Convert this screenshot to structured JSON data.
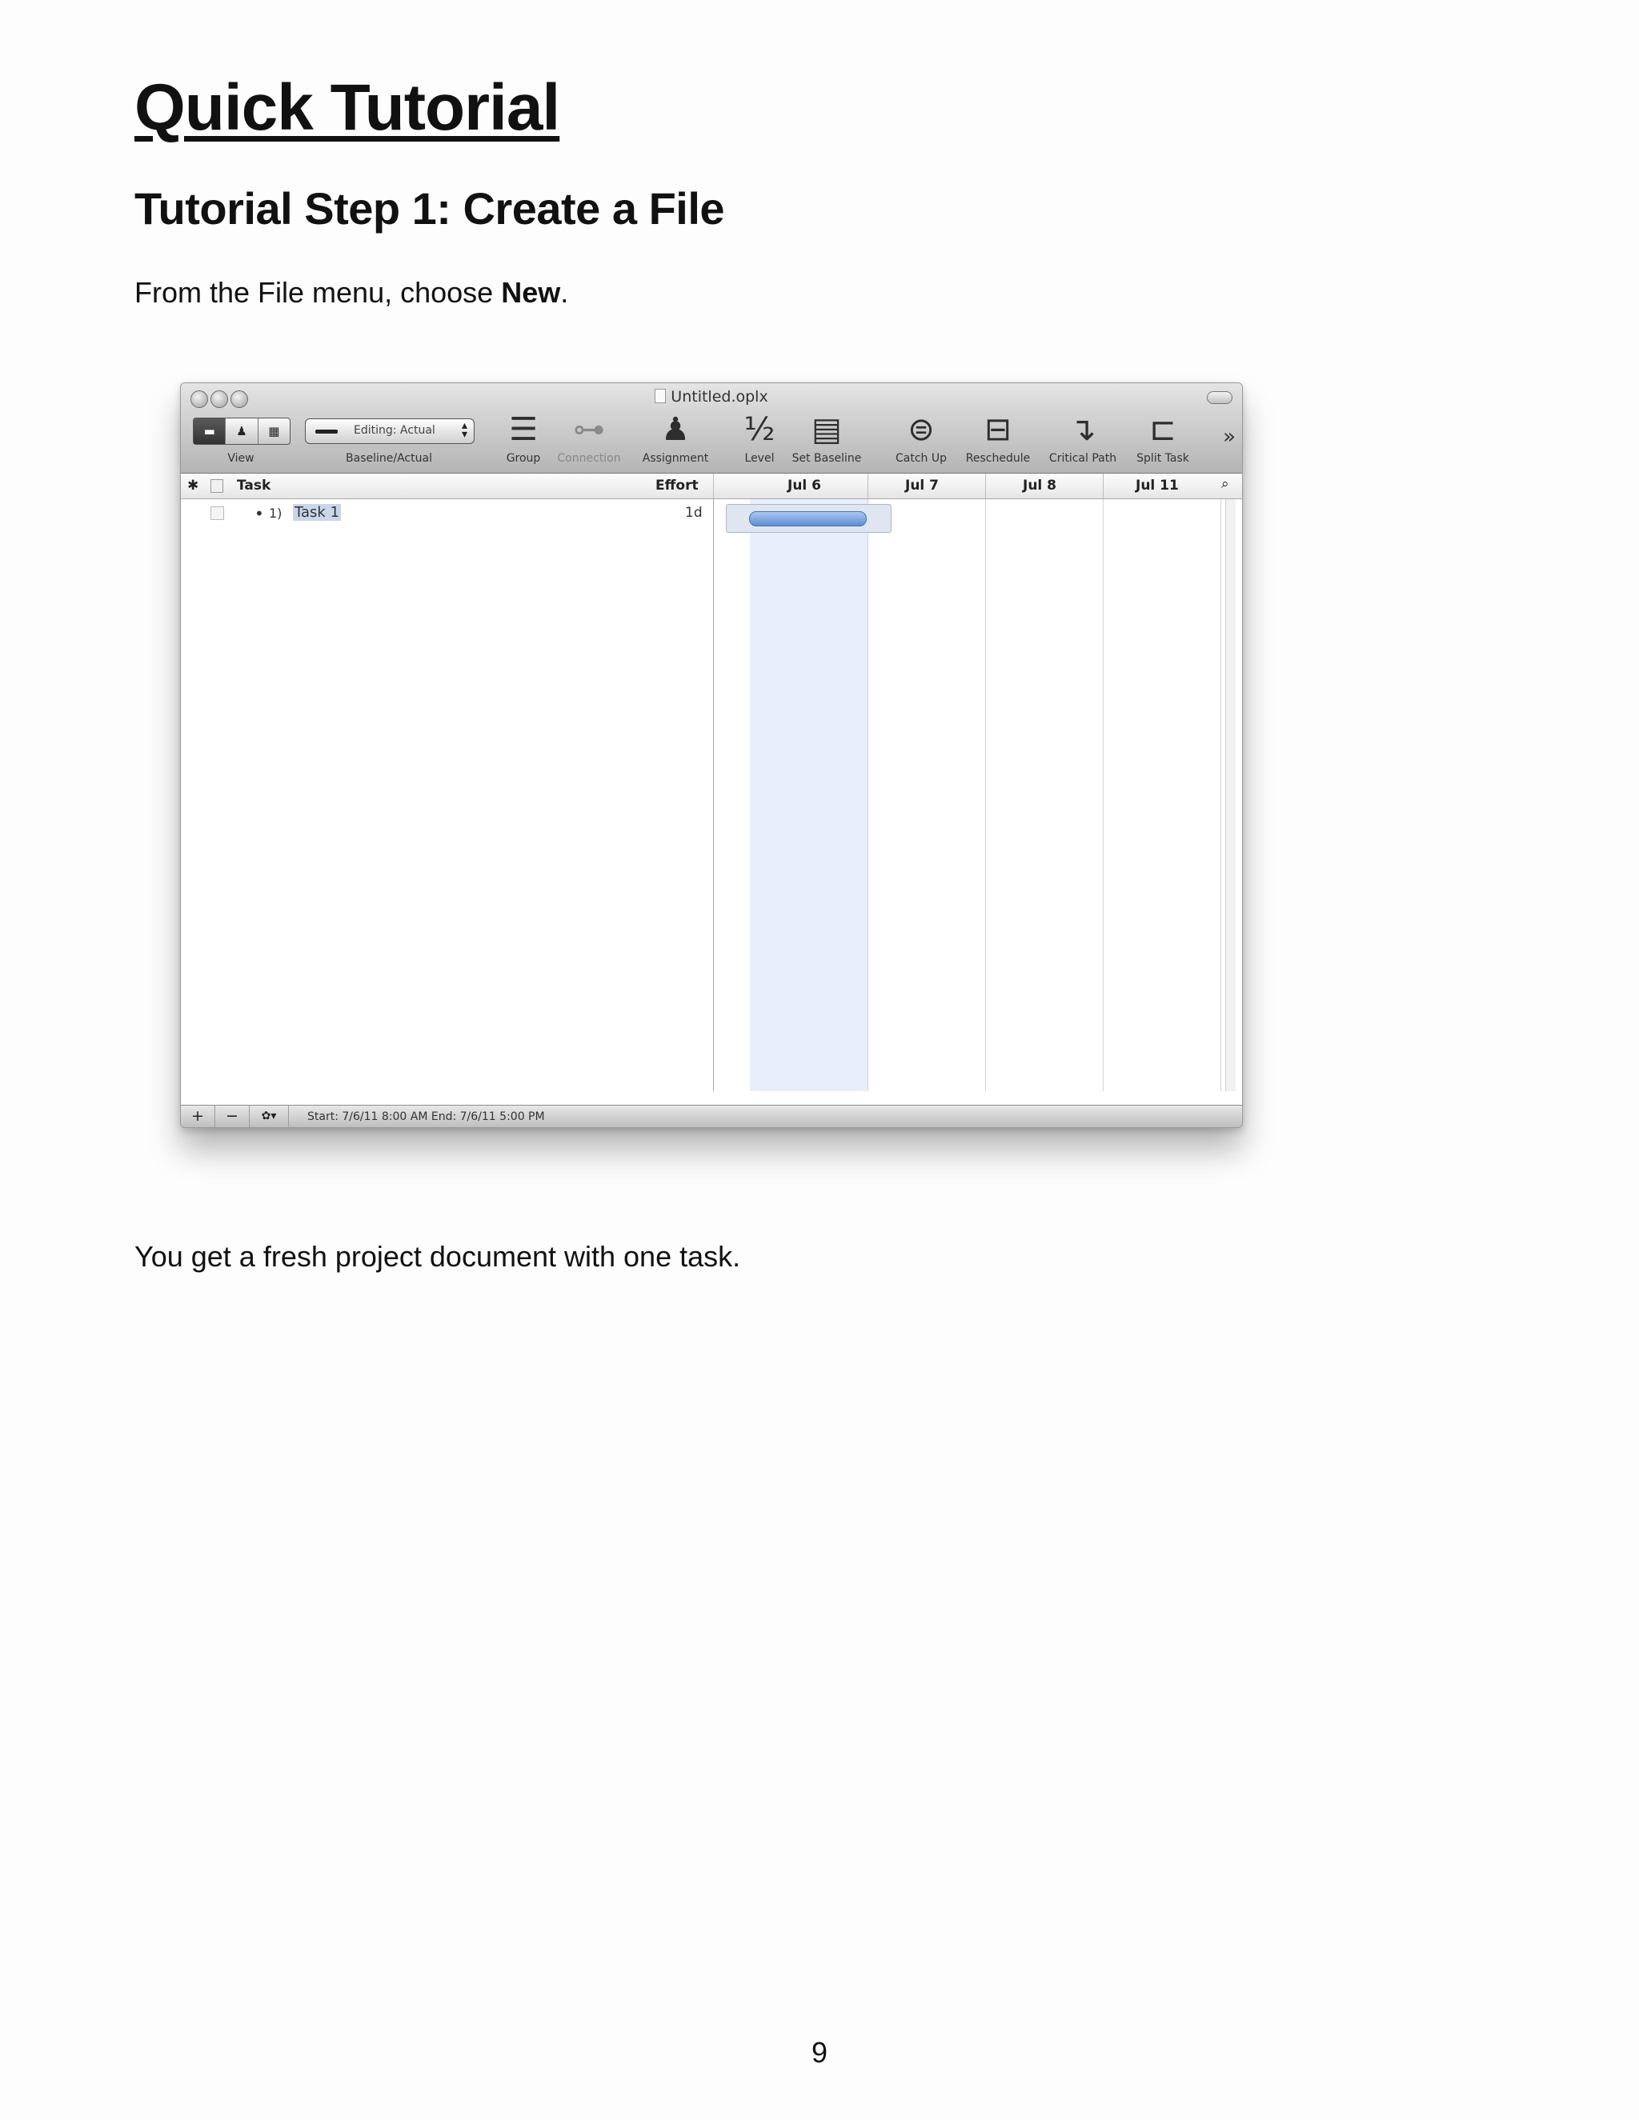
{
  "page": {
    "title": "Quick Tutorial",
    "step_title": "Tutorial Step 1: Create a File",
    "intro_before": "From the File menu, choose ",
    "intro_bold": "New",
    "intro_after": ".",
    "outro": "You get a fresh project document with one task.",
    "page_number": "9"
  },
  "window": {
    "title": "Untitled.oplx",
    "toolbar": {
      "view_label": "View",
      "baseline_popup_value": "Editing: Actual",
      "baseline_label": "Baseline/Actual",
      "group_label": "Group",
      "connection_label": "Connection",
      "assignment_label": "Assignment",
      "level_label": "Level",
      "set_baseline_label": "Set Baseline",
      "catch_up_label": "Catch Up",
      "reschedule_label": "Reschedule",
      "critical_path_label": "Critical Path",
      "split_task_label": "Split Task",
      "overflow": "»"
    },
    "columns": {
      "task": "Task",
      "effort": "Effort",
      "dates": [
        "Jul 6",
        "Jul 7",
        "Jul 8",
        "Jul 11"
      ]
    },
    "rows": [
      {
        "number": "1)",
        "name": "Task 1",
        "effort": "1d"
      }
    ],
    "statusbar": {
      "add": "+",
      "remove": "−",
      "gear": "✿▾",
      "status": "Start: 7/6/11 8:00 AM End: 7/6/11 5:00 PM"
    }
  }
}
